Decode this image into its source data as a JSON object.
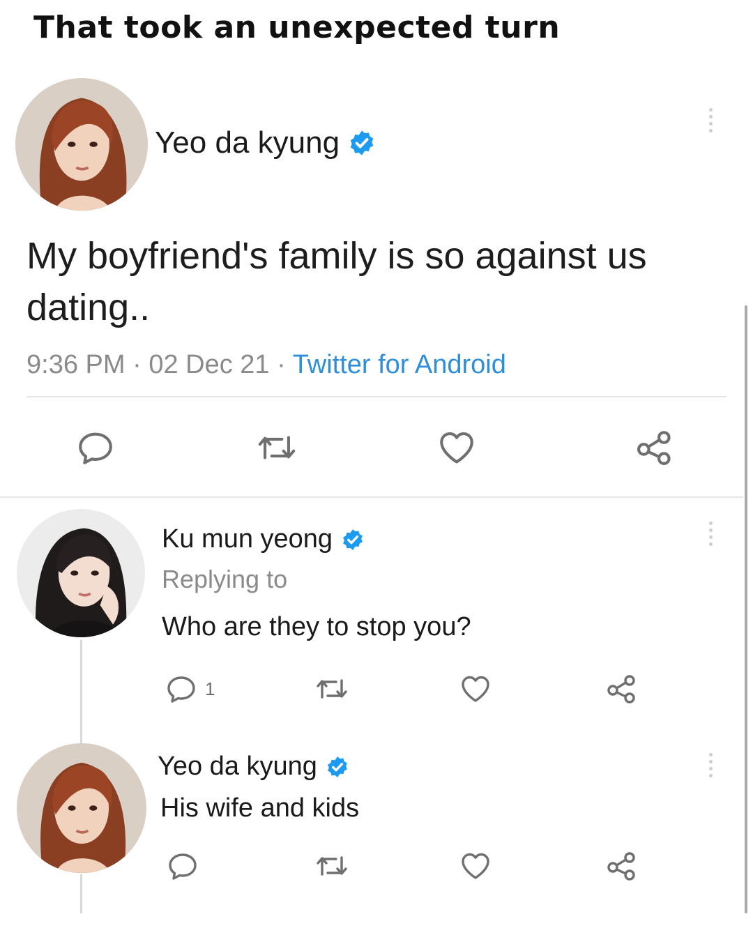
{
  "caption": "That took an unexpected turn",
  "colors": {
    "verified_badge": "#1d9bf0",
    "client_link": "#2e8ed9",
    "meta_text": "#8a8a8a",
    "icon_stroke": "#6f6f6f"
  },
  "main_tweet": {
    "author": "Yeo da kyung",
    "verified": true,
    "text": "My boyfriend's family is so against us dating..",
    "time": "9:36 PM",
    "date": "02 Dec 21",
    "client": "Twitter for Android",
    "icons": [
      "reply-icon",
      "retweet-icon",
      "like-icon",
      "share-icon"
    ]
  },
  "reply_1": {
    "author": "Ku mun yeong",
    "verified": true,
    "replying_to": "Replying to",
    "text": "Who are they to stop you?",
    "reply_count": "1",
    "icons": [
      "reply-icon",
      "retweet-icon",
      "like-icon",
      "share-icon"
    ]
  },
  "reply_2": {
    "author": "Yeo da kyung",
    "verified": true,
    "text": "His wife and kids",
    "icons": [
      "reply-icon",
      "retweet-icon",
      "like-icon",
      "share-icon"
    ]
  }
}
